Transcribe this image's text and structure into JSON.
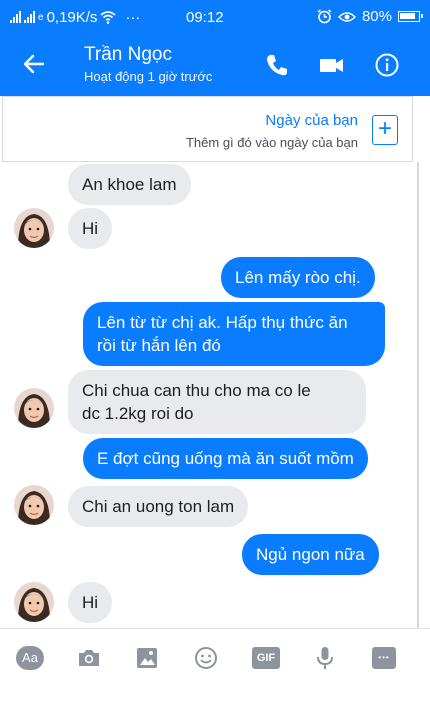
{
  "status_bar": {
    "network_speed": "0,19K/s",
    "dots": "···",
    "time": "09:12",
    "battery": "80%",
    "network_glyphs": "e"
  },
  "header": {
    "contact_name": "Trần Ngọc",
    "status": "Hoạt động 1 giờ trước"
  },
  "day_banner": {
    "title": "Ngày của bạn",
    "subtitle": "Thêm gì đó vào ngày của bạn",
    "add_glyph": "+"
  },
  "messages": [
    {
      "from": "them",
      "text": "An khoe lam"
    },
    {
      "from": "them",
      "text": "Hi"
    },
    {
      "from": "me",
      "text": "Lên mấy ròo chị."
    },
    {
      "from": "me",
      "line1": "Lên từ từ chị ak. Hấp thụ thức ăn",
      "line2": "rồi từ hắn lên đó"
    },
    {
      "from": "them",
      "line1": "Chi chua can thu cho ma co le",
      "line2": "dc 1.2kg roi do"
    },
    {
      "from": "me",
      "text": "E đợt cũng uống mà ăn suốt mồm"
    },
    {
      "from": "them",
      "text": "Chi an uong ton lam"
    },
    {
      "from": "me",
      "text": "Ngủ ngon nữa"
    },
    {
      "from": "them",
      "text": "Hi"
    }
  ],
  "composer": {
    "text_button": "Aa",
    "gif_button": "GIF",
    "more_dots": "•••"
  },
  "colors": {
    "brand_blue": "#0a7cff",
    "incoming_bubble": "#e9eaed",
    "icon_gray": "#8d949e"
  },
  "icons": [
    "back-arrow-icon",
    "phone-icon",
    "video-camera-icon",
    "info-icon",
    "camera-icon",
    "image-icon",
    "emoji-icon",
    "gif-icon",
    "microphone-icon",
    "more-icon"
  ]
}
